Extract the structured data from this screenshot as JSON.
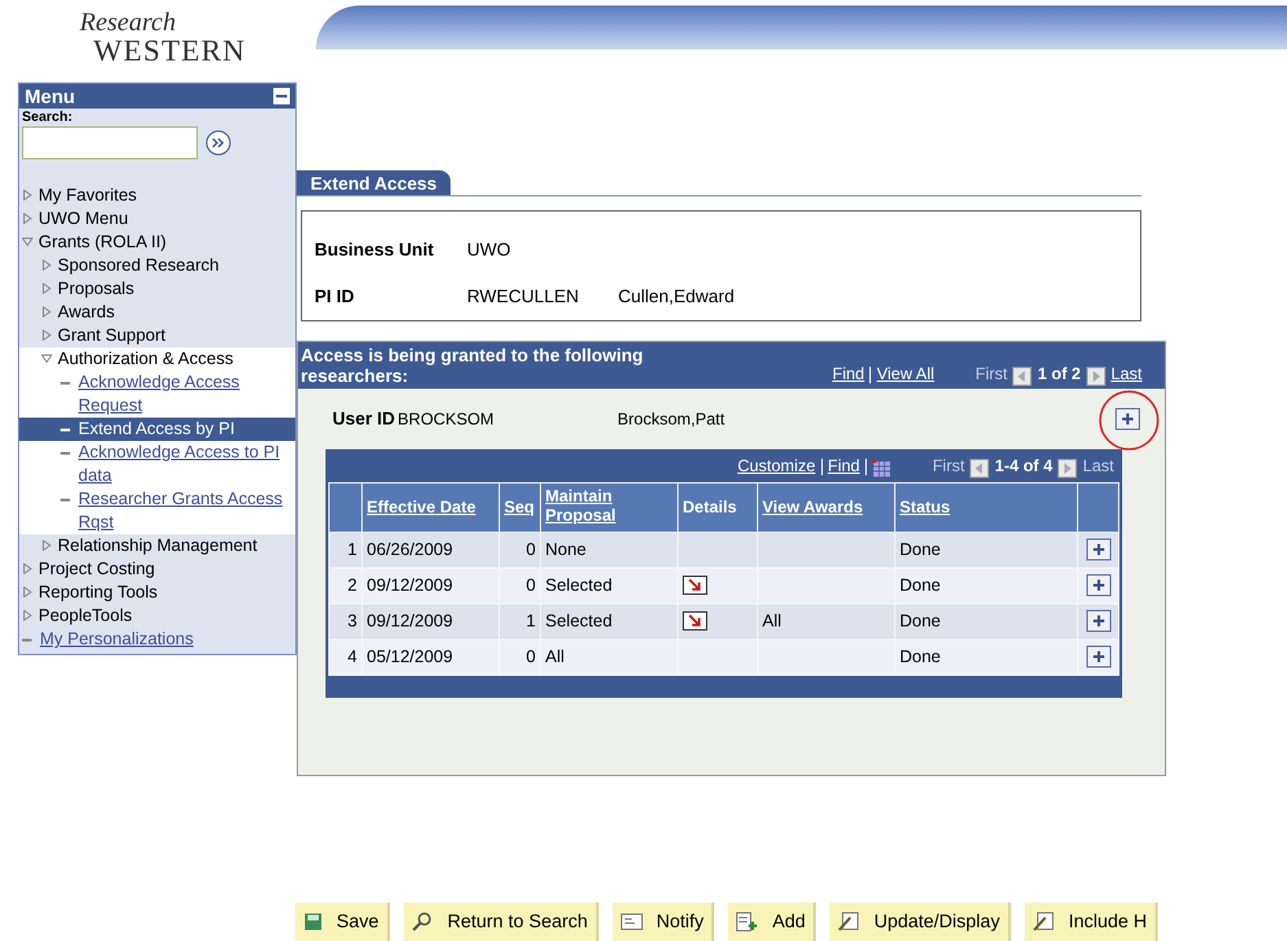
{
  "logo": {
    "line_1": "Research",
    "line_2": "WESTERN"
  },
  "menu": {
    "title": "Menu",
    "search_label": "Search:",
    "items": [
      {
        "kind": "folder",
        "label": "My Favorites",
        "expanded": false
      },
      {
        "kind": "folder",
        "label": "UWO Menu",
        "expanded": false
      },
      {
        "kind": "folder",
        "label": "Grants (ROLA II)",
        "expanded": true,
        "children": [
          {
            "kind": "folder",
            "label": "Sponsored Research",
            "expanded": false
          },
          {
            "kind": "folder",
            "label": "Proposals",
            "expanded": false
          },
          {
            "kind": "folder",
            "label": "Awards",
            "expanded": false
          },
          {
            "kind": "folder",
            "label": "Grant Support",
            "expanded": false
          },
          {
            "kind": "folder",
            "label": "Authorization & Access",
            "expanded": true,
            "children": [
              {
                "kind": "link",
                "label": "Acknowledge Access Request",
                "selected": false
              },
              {
                "kind": "link",
                "label": "Extend Access by PI",
                "selected": true
              },
              {
                "kind": "link",
                "label": "Acknowledge Access to PI data",
                "selected": false
              },
              {
                "kind": "link",
                "label": "Researcher Grants Access Rqst",
                "selected": false
              }
            ]
          },
          {
            "kind": "folder",
            "label": "Relationship Management",
            "expanded": false
          }
        ]
      },
      {
        "kind": "folder",
        "label": "Project Costing",
        "expanded": false
      },
      {
        "kind": "folder",
        "label": "Reporting Tools",
        "expanded": false
      },
      {
        "kind": "folder",
        "label": "PeopleTools",
        "expanded": false
      },
      {
        "kind": "link",
        "label": "My Personalizations",
        "selected": false
      }
    ]
  },
  "tabs": [
    {
      "label": "Extend Access",
      "selected": true
    }
  ],
  "fields": [
    {
      "label": "Business Unit",
      "value": "UWO"
    },
    {
      "label": "PI ID",
      "value": "RWECULLEN",
      "description": "Cullen,Edward"
    }
  ],
  "researchers": {
    "title": "Access is being granted to the following researchers:",
    "find": "Find",
    "view_all": "View All",
    "first": "First",
    "count": "1 of 2",
    "last": "Last",
    "user_id_label": "User ID",
    "user_id": "BROCKSOM",
    "user_name": "Brocksom,Patt",
    "grid": {
      "customize": "Customize",
      "find": "Find",
      "first": "First",
      "count": "1-4 of 4",
      "last": "Last",
      "columns": [
        "Effective Date",
        "Seq",
        "Maintain Proposal",
        "Details",
        "View Awards",
        "Status"
      ],
      "rows": [
        {
          "num": "1",
          "date": "06/26/2009",
          "seq": "0",
          "proposal": "None",
          "details": false,
          "awards": "",
          "status": "Done"
        },
        {
          "num": "2",
          "date": "09/12/2009",
          "seq": "0",
          "proposal": "Selected",
          "details": true,
          "awards": "",
          "status": "Done"
        },
        {
          "num": "3",
          "date": "09/12/2009",
          "seq": "1",
          "proposal": "Selected",
          "details": true,
          "awards": "All",
          "status": "Done"
        },
        {
          "num": "4",
          "date": "05/12/2009",
          "seq": "0",
          "proposal": "All",
          "details": false,
          "awards": "",
          "status": "Done"
        }
      ]
    }
  },
  "toolbar": [
    {
      "kind": "save",
      "label": "Save"
    },
    {
      "kind": "search",
      "label": "Return to Search"
    },
    {
      "kind": "notify",
      "label": "Notify"
    },
    {
      "kind": "add",
      "label": "Add"
    },
    {
      "kind": "update",
      "label": "Update/Display"
    },
    {
      "kind": "include",
      "label": "Include H"
    }
  ]
}
